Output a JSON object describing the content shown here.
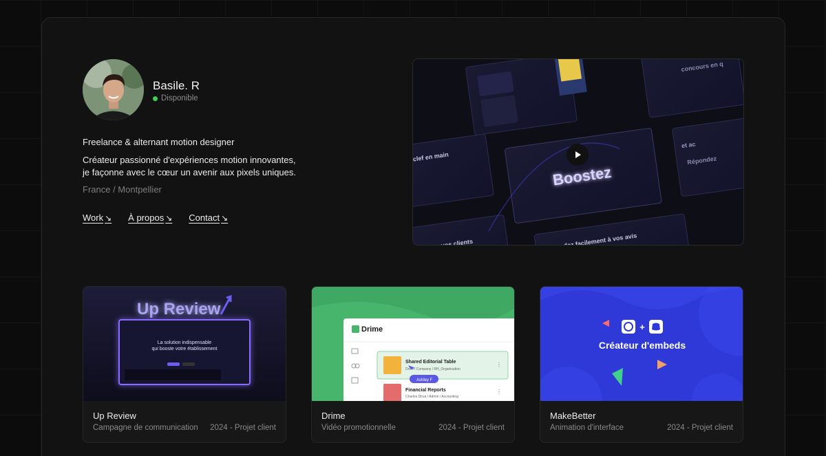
{
  "profile": {
    "name": "Basile. R",
    "status": "Disponible",
    "role": "Freelance & alternant motion designer",
    "bio_line1": "Créateur passionné d'expériences motion innovantes,",
    "bio_line2": "je façonne avec le cœur un avenir aux pixels uniques.",
    "location": "France / Montpellier",
    "status_color": "#3ecf5a"
  },
  "nav": [
    {
      "label": "Work",
      "arrow": "↘"
    },
    {
      "label": "À propos",
      "arrow": "↘"
    },
    {
      "label": "Contact",
      "arrow": "↘"
    }
  ],
  "video": {
    "texts": {
      "concours": "concours en q",
      "clef": "ut clef en main",
      "boostez": "Boostez",
      "repondez": "Répondez",
      "et": "et ac",
      "contactez": "ontactez vos clients",
      "facilement": "dez facilement à vos avis"
    }
  },
  "projects": [
    {
      "title": "Up Review",
      "subtitle": "Campagne de communication",
      "meta": "2024 - Projet client",
      "thumb_heading": "Up Review",
      "thumb_line1": "La solution indispensable",
      "thumb_line2": "qui booste votre établissement"
    },
    {
      "title": "Drime",
      "subtitle": "Vidéo promotionnelle",
      "meta": "2024 - Projet client",
      "thumb_brand": "Drime",
      "thumb_row1": "Shared Editorial Table",
      "thumb_row1_sub": "Drive / Company / RH_Organisation",
      "thumb_row2": "Financial Reports",
      "thumb_row2_sub": "Charles Dirva / Admin / Accounting",
      "thumb_cursor": "Ashley F"
    },
    {
      "title": "MakeBetter",
      "subtitle": "Animation d'interface",
      "meta": "2024 - Projet client",
      "thumb_heading": "Créateur d'embeds",
      "thumb_plus": "+"
    }
  ]
}
